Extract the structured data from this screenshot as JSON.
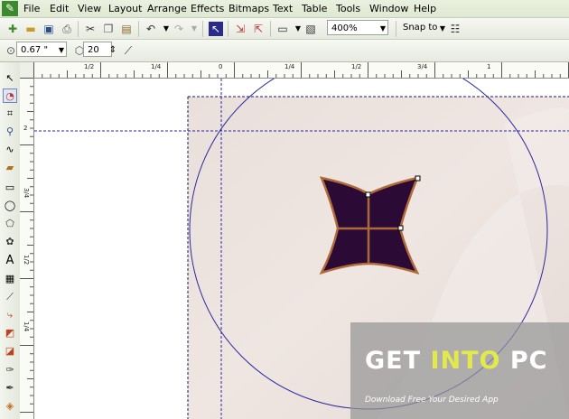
{
  "menu": [
    "File",
    "Edit",
    "View",
    "Layout",
    "Arrange",
    "Effects",
    "Bitmaps",
    "Text",
    "Table",
    "Tools",
    "Window",
    "Help"
  ],
  "toolbar": {
    "zoom_value": "400%",
    "snap_label": "Snap to"
  },
  "property_bar": {
    "outline_width": "0.67 \"",
    "points_value": "20"
  },
  "ruler_h_labels": [
    "1/2",
    "1/4",
    "0",
    "1/4",
    "1/2",
    "3/4",
    "1"
  ],
  "ruler_v_labels": [
    "2",
    "3/4",
    "1/2",
    "1/4"
  ],
  "watermark": {
    "part1": "GET ",
    "part2": "INTO",
    "part3": " PC",
    "subtitle": "Download Free Your Desired App"
  },
  "colors": {
    "shape_fill": "#2b0a36",
    "shape_outline": "#b06a3a",
    "guide": "#2a2aa0",
    "accent_green": "#3d8a2e"
  }
}
